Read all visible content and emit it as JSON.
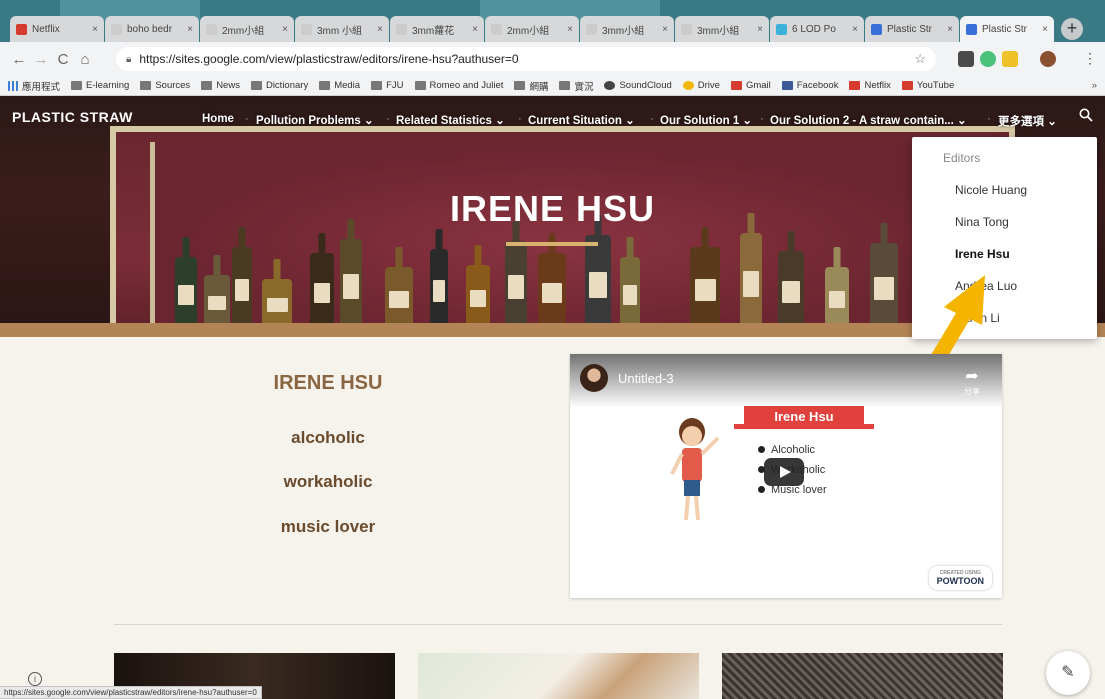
{
  "browser": {
    "tabs": [
      {
        "label": "Netflix",
        "color": "#d63b2f"
      },
      {
        "label": "boho bedr",
        "color": "#cccccc"
      },
      {
        "label": "2mm小組",
        "color": "#cccccc"
      },
      {
        "label": "3mm 小組",
        "color": "#cccccc"
      },
      {
        "label": "3mm蘿花",
        "color": "#cccccc"
      },
      {
        "label": "2mm小組",
        "color": "#cccccc"
      },
      {
        "label": "3mm小組",
        "color": "#cccccc"
      },
      {
        "label": "3mm小組",
        "color": "#cccccc"
      },
      {
        "label": "6 LOD Po",
        "color": "#3bb0d8"
      },
      {
        "label": "Plastic Str",
        "color": "#3b6fd8"
      },
      {
        "label": "Plastic Str",
        "color": "#3b6fd8"
      }
    ],
    "active_tab": 10,
    "new_tab": "+",
    "url": "https://sites.google.com/view/plasticstraw/editors/irene-hsu?authuser=0",
    "bookmarks": [
      {
        "label": "應用程式",
        "icon": "apps"
      },
      {
        "label": "E-learning",
        "icon": "folder"
      },
      {
        "label": "Sources",
        "icon": "folder"
      },
      {
        "label": "News",
        "icon": "folder"
      },
      {
        "label": "Dictionary",
        "icon": "folder"
      },
      {
        "label": "Media",
        "icon": "folder"
      },
      {
        "label": "FJU",
        "icon": "folder"
      },
      {
        "label": "Romeo and Juliet",
        "icon": "folder"
      },
      {
        "label": "網購",
        "icon": "folder"
      },
      {
        "label": "實況",
        "icon": "folder"
      },
      {
        "label": "SoundCloud",
        "icon": "soundcloud"
      },
      {
        "label": "Drive",
        "icon": "drive"
      },
      {
        "label": "Gmail",
        "icon": "gmail"
      },
      {
        "label": "Facebook",
        "icon": "facebook"
      },
      {
        "label": "Netflix",
        "icon": "netflix"
      },
      {
        "label": "YouTube",
        "icon": "youtube"
      }
    ],
    "bookmarks_more": "»",
    "status_url": "https://sites.google.com/view/plasticstraw/editors/irene-hsu?authuser=0"
  },
  "site": {
    "brand": "PLASTIC STRAW",
    "nav": {
      "home": "Home",
      "pollution": "Pollution Problems",
      "stats": "Related Statistics",
      "current": "Current Situation",
      "sol1": "Our Solution 1",
      "sol2": "Our Solution 2 - A straw contain...",
      "more": "更多選項"
    },
    "hero_title": "IRENE HSU",
    "dropdown": {
      "heading": "Editors",
      "items": [
        "Nicole Huang",
        "Nina Tong",
        "Irene Hsu",
        "Andrea Luo",
        "Karen Li"
      ],
      "active_index": 2
    },
    "profile": {
      "name": "IRENE HSU",
      "traits": [
        "alcoholic",
        "workaholic",
        "music lover"
      ]
    },
    "video": {
      "title": "Untitled-3",
      "share": "分享",
      "banner": "Irene Hsu",
      "items": [
        "Alcoholic",
        "Workaholic",
        "Music lover"
      ],
      "badge_top": "CREATED USING",
      "badge": "POWTOON"
    }
  },
  "colors": {
    "accent_arrow": "#f5b400",
    "heading_brown": "#8a6542"
  }
}
